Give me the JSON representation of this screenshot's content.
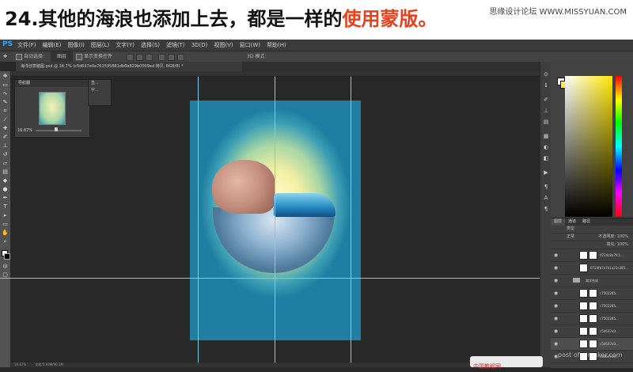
{
  "banner": {
    "title_prefix": "24.其他的海浪也添加上去，都是一样的",
    "title_highlight": "使用蒙版。",
    "watermark": "思缘设计论坛 WWW.MISSYUAN.COM"
  },
  "menubar": {
    "app_badge": "PS",
    "items": [
      "文件(F)",
      "编辑(E)",
      "图像(I)",
      "图层(L)",
      "文字(Y)",
      "选择(S)",
      "滤镜(T)",
      "3D(D)",
      "视图(V)",
      "窗口(W)",
      "帮助(H)"
    ]
  },
  "options": {
    "auto_select_label": "自动选择:",
    "auto_select_value": "图层",
    "transform_label": "显示变换控件",
    "mode_3d_label": "3D 模式:"
  },
  "document_tab": {
    "title": "海洋创意脑图.psd @ 16.7% (c5d637e0a761595881db6b829b0009ed 拷贝, RGB/8) *"
  },
  "navigator": {
    "title": "导航器",
    "zoom": "16.67%",
    "zoom_fraction": 0.45
  },
  "mini_panel": {
    "item1": "直...",
    "item2": "字..."
  },
  "colors": {
    "foreground": "#ffffff",
    "background": "#ffec40",
    "guide": "#6fd2e6",
    "title_highlight": "#e8401c"
  },
  "layers_panel": {
    "tabs": [
      "图层",
      "通道",
      "路径"
    ],
    "kind_label": "类型",
    "blend_mode": "正常",
    "opacity_label": "不透明度:",
    "opacity_value": "100%",
    "fill_label": "填充:",
    "fill_value": "100%",
    "rows": [
      {
        "name": "0724c8a7fc1...",
        "type": "layer"
      },
      {
        "name": "0724fb7a7b1a21c385...",
        "type": "layer"
      },
      {
        "name": "海洋合成",
        "type": "group"
      },
      {
        "name": "c7502285...",
        "type": "layer"
      },
      {
        "name": "c7502285...",
        "type": "layer"
      },
      {
        "name": "c7502285...",
        "type": "layer"
      },
      {
        "name": "c5d637e0...",
        "type": "layer"
      },
      {
        "name": "c5d637e0...",
        "type": "layer"
      },
      {
        "name": "c5d637e0...",
        "type": "layer"
      }
    ]
  },
  "status": {
    "zoom": "16.67%",
    "doc_info": "文档:5.93M/90.1M"
  },
  "overlay_watermark": "post of uimaker.com",
  "corner_logo": "中国教程网"
}
